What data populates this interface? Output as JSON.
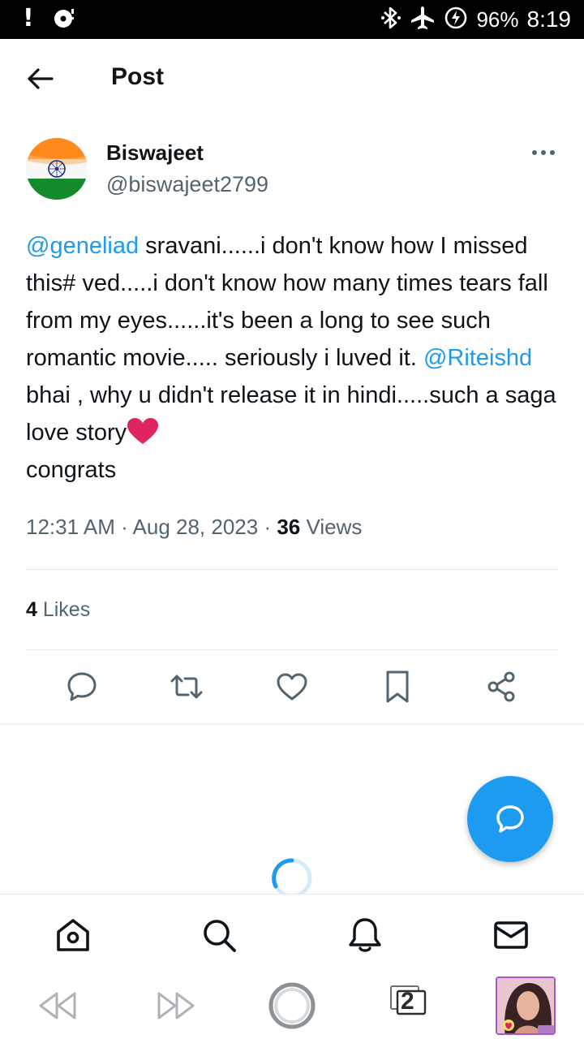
{
  "status_bar": {
    "left_icons": [
      "alert-icon",
      "media-icon"
    ],
    "alert_glyph": "!",
    "icons": [
      "bluetooth-icon",
      "airplane-mode-icon",
      "battery-charging-icon"
    ],
    "battery": "96%",
    "time": "8:19"
  },
  "header": {
    "title": "Post",
    "back_icon": "back-arrow-icon"
  },
  "post": {
    "author_name": "Biswajeet",
    "author_handle": "@biswajeet2799",
    "avatar": "indian-flag-avatar",
    "mention_1": "@geneliad",
    "text_1": " sravani......i don't know how I missed this# ved.....i don't know how many times tears fall from my eyes......it's been a long to see such romantic movie..... seriously i luved it. ",
    "mention_2": "@Riteishd",
    "text_2": " bhai , why u didn't release it in hindi.....such a saga love story",
    "emoji": "red-heart",
    "text_3": "congrats",
    "time": "12:31 AM",
    "separator": " · ",
    "date": "Aug 28, 2023",
    "views_count": "36",
    "views_label": " Views",
    "likes_count": "4",
    "likes_label": " Likes"
  },
  "actions": [
    "reply-icon",
    "repost-icon",
    "like-icon",
    "bookmark-icon",
    "share-icon"
  ],
  "fab": {
    "icon": "compose-reply-icon"
  },
  "tab_bar": [
    "home-icon",
    "search-icon",
    "notifications-icon",
    "messages-icon"
  ],
  "system_bar": {
    "buttons": [
      "rewind-icon",
      "fast-forward-icon",
      "home-circle-icon",
      "recent-apps-icon",
      "app-thumbnail"
    ],
    "recent_count": "2"
  },
  "colors": {
    "accent": "#1d9bf0",
    "text": "#0f1419",
    "secondary": "#536471",
    "heart": "#e0245e"
  }
}
